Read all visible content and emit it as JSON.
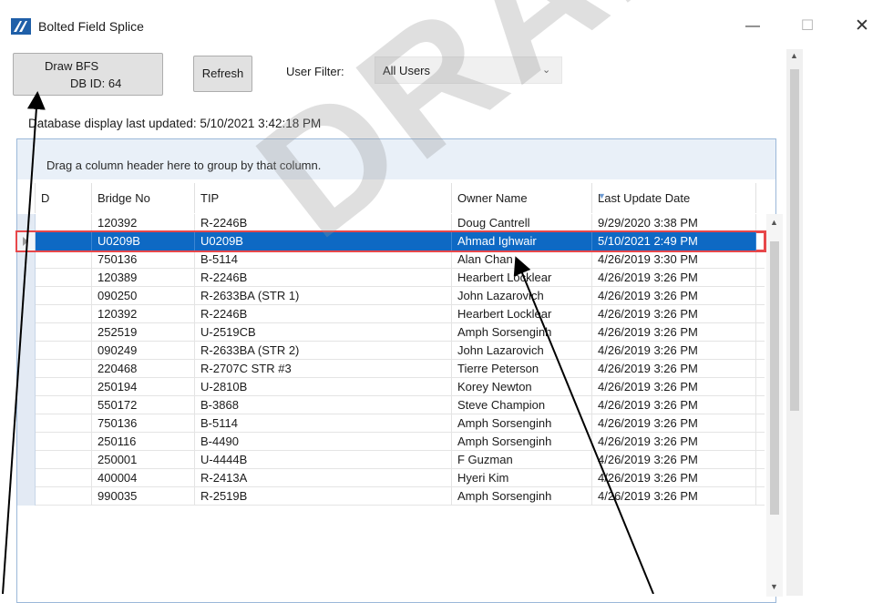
{
  "window": {
    "title": "Bolted Field Splice",
    "icons": [
      "app-logo-icon",
      "minimize-icon",
      "maximize-icon",
      "close-icon"
    ],
    "minimize_glyph": "—",
    "maximize_glyph": "☐",
    "close_glyph": "✕"
  },
  "toolbar": {
    "draw_label_line1": "Draw BFS",
    "draw_label_line2": "DB ID: 64",
    "refresh_label": "Refresh",
    "filter_label": "User Filter:",
    "filter_value": "All Users"
  },
  "status": {
    "last_updated": "Database display last updated:  5/10/2021 3:42:18 PM"
  },
  "grid": {
    "group_panel_text": "Drag a column header here to group by that column.",
    "columns": [
      "D",
      "Bridge No",
      "TIP",
      "Owner Name",
      "Last Update Date"
    ],
    "sorted_column": "Last Update Date",
    "selected_row_index": 1,
    "rows": [
      [
        "",
        "120392",
        "R-2246B",
        "Doug Cantrell",
        "9/29/2020 3:38 PM"
      ],
      [
        "",
        "U0209B",
        "U0209B",
        "Ahmad Ighwair",
        "5/10/2021 2:49 PM"
      ],
      [
        "",
        "750136",
        "B-5114",
        "Alan Chan",
        "4/26/2019 3:30 PM"
      ],
      [
        "",
        "120389",
        "R-2246B",
        "Hearbert Locklear",
        "4/26/2019 3:26 PM"
      ],
      [
        "",
        "090250",
        "R-2633BA (STR 1)",
        "John Lazarovich",
        "4/26/2019 3:26 PM"
      ],
      [
        "",
        "120392",
        "R-2246B",
        "Hearbert Locklear",
        "4/26/2019 3:26 PM"
      ],
      [
        "",
        "252519",
        "U-2519CB",
        "Amph Sorsenginh",
        "4/26/2019 3:26 PM"
      ],
      [
        "",
        "090249",
        "R-2633BA (STR 2)",
        "John Lazarovich",
        "4/26/2019 3:26 PM"
      ],
      [
        "",
        "220468",
        "R-2707C STR #3",
        "Tierre Peterson",
        "4/26/2019 3:26 PM"
      ],
      [
        "",
        "250194",
        "U-2810B",
        "Korey Newton",
        "4/26/2019 3:26 PM"
      ],
      [
        "",
        "550172",
        "B-3868",
        "Steve Champion",
        "4/26/2019 3:26 PM"
      ],
      [
        "",
        "750136",
        "B-5114",
        "Amph Sorsenginh",
        "4/26/2019 3:26 PM"
      ],
      [
        "",
        "250116",
        "B-4490",
        "Amph Sorsenginh",
        "4/26/2019 3:26 PM"
      ],
      [
        "",
        "250001",
        "U-4444B",
        "F Guzman",
        "4/26/2019 3:26 PM"
      ],
      [
        "",
        "400004",
        "R-2413A",
        "Hyeri Kim",
        "4/26/2019 3:26 PM"
      ],
      [
        "",
        "990035",
        "R-2519B",
        "Amph Sorsenginh",
        "4/26/2019 3:26 PM"
      ]
    ]
  },
  "watermark": "DRAFT",
  "colors": {
    "selection": "#0e69c4",
    "selection_outline": "#e7474a",
    "group_panel": "#e9f0f8",
    "sort_indicator": "#6d9bd3"
  }
}
